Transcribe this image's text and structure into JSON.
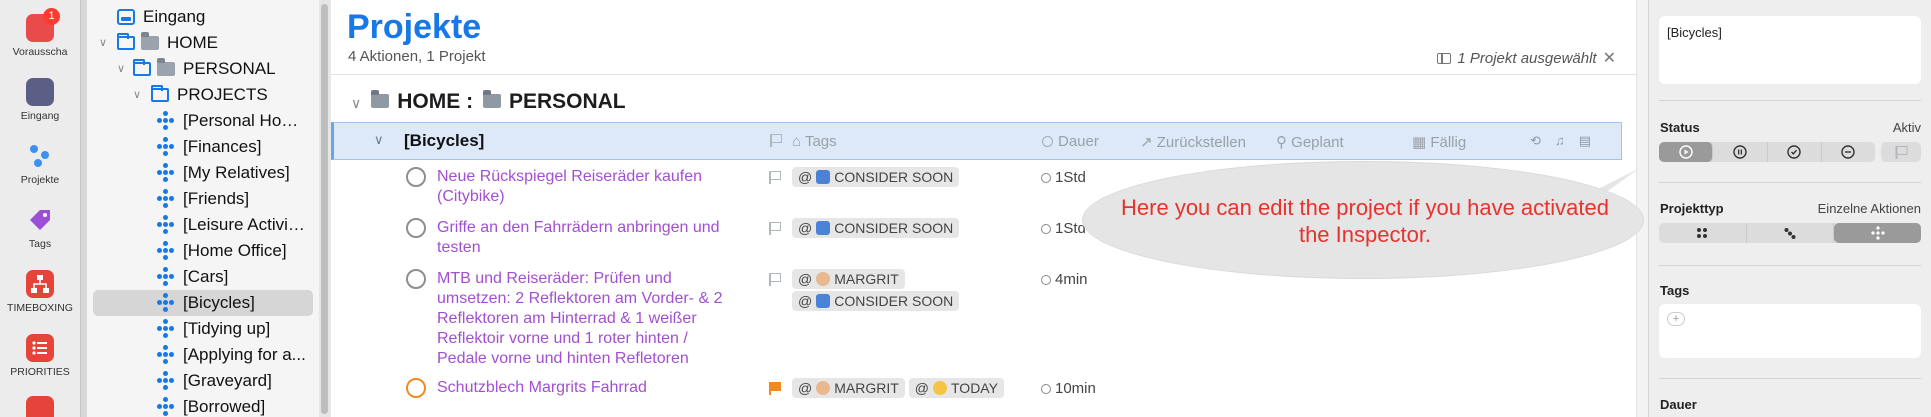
{
  "rail": {
    "items": [
      {
        "label": "Vorausscha",
        "icon": "forecast-calendar-icon",
        "badge": "1"
      },
      {
        "label": "Eingang",
        "icon": "inbox-tray-icon"
      },
      {
        "label": "Projekte",
        "icon": "projects-dots-icon"
      },
      {
        "label": "Tags",
        "icon": "tag-icon"
      },
      {
        "label": "TIMEBOXING",
        "icon": "hierarchy-icon"
      },
      {
        "label": "PRIORITIES",
        "icon": "list-icon"
      },
      {
        "label": "",
        "icon": "calendar-17-icon"
      }
    ]
  },
  "sidebar": {
    "items": [
      {
        "label": "Eingang",
        "indent": 0,
        "icon": "inbox",
        "chevron": false
      },
      {
        "label": "HOME",
        "indent": 0,
        "icon": "folder-emoji",
        "chevron": true
      },
      {
        "label": "PERSONAL",
        "indent": 1,
        "icon": "folder-emoji",
        "chevron": true
      },
      {
        "label": "PROJECTS",
        "indent": 2,
        "icon": "folder",
        "chevron": true
      },
      {
        "label": "[Personal Home]",
        "indent": 3,
        "icon": "project"
      },
      {
        "label": "[Finances]",
        "indent": 3,
        "icon": "project"
      },
      {
        "label": "[My Relatives]",
        "indent": 3,
        "icon": "project"
      },
      {
        "label": "[Friends]",
        "indent": 3,
        "icon": "project"
      },
      {
        "label": "[Leisure Activiti...",
        "indent": 3,
        "icon": "project"
      },
      {
        "label": "[Home Office]",
        "indent": 3,
        "icon": "project"
      },
      {
        "label": "[Cars]",
        "indent": 3,
        "icon": "project"
      },
      {
        "label": "[Bicycles]",
        "indent": 3,
        "icon": "project",
        "selected": true
      },
      {
        "label": "[Tidying up]",
        "indent": 3,
        "icon": "project"
      },
      {
        "label": "[Applying for a...",
        "indent": 3,
        "icon": "project"
      },
      {
        "label": "[Graveyard]",
        "indent": 3,
        "icon": "project"
      },
      {
        "label": "[Borrowed]",
        "indent": 3,
        "icon": "project"
      }
    ]
  },
  "main": {
    "title": "Projekte",
    "subtitle": "4 Aktionen, 1 Projekt",
    "selection_info": "1 Projekt ausgewählt",
    "close_glyph": "✕",
    "group": {
      "home": "HOME",
      "separator": ":",
      "personal": "PERSONAL"
    },
    "project_row": {
      "name": "[Bicycles]",
      "columns": {
        "tags": "Tags",
        "duration": "Dauer",
        "defer": "Zurückstellen",
        "planned": "Geplant",
        "due": "Fällig"
      }
    },
    "tasks": [
      {
        "title": "Neue Rückspiegel Reiseräder kaufen (Citybike)",
        "flagged": false,
        "tags": [
          {
            "prefix": "@",
            "emoji": "book",
            "text": "CONSIDER SOON"
          }
        ],
        "duration": "1Std"
      },
      {
        "title": "Griffe an den Fahrrädern anbringen und testen",
        "flagged": false,
        "tags": [
          {
            "prefix": "@",
            "emoji": "book",
            "text": "CONSIDER SOON"
          }
        ],
        "duration": "1Std"
      },
      {
        "title": "MTB und Reiseräder: Prüfen und umsetzen: 2 Reflektoren am Vorder- & 2 Reflektoren am Hinterrad & 1 weißer Reflektoir vorne und 1 roter hinten / Pedale vorne und hinten Refletoren",
        "flagged": false,
        "tags": [
          {
            "prefix": "@",
            "emoji": "face",
            "text": "MARGRIT"
          },
          {
            "prefix": "@",
            "emoji": "book",
            "text": "CONSIDER SOON"
          }
        ],
        "duration": "4min"
      },
      {
        "title": "Schutzblech Margrits Fahrrad",
        "flagged": true,
        "tags": [
          {
            "prefix": "@",
            "emoji": "face",
            "text": "MARGRIT"
          },
          {
            "prefix": "@",
            "emoji": "sun",
            "text": "TODAY"
          }
        ],
        "duration": "10min"
      }
    ]
  },
  "annotation": {
    "text": "Here you can edit the project if you have activated the Inspector."
  },
  "inspector": {
    "name_value": "[Bicycles]",
    "status_label": "Status",
    "status_value": "Aktiv",
    "type_label": "Projekttyp",
    "type_value": "Einzelne Aktionen",
    "tags_label": "Tags",
    "add_tag_glyph": "+",
    "duration_label": "Dauer"
  },
  "colors": {
    "accent": "#1778e6",
    "task_text": "#a34fd1",
    "flag": "#f08a24",
    "annotation": "#e8322d",
    "selection": "#dde9f8"
  }
}
